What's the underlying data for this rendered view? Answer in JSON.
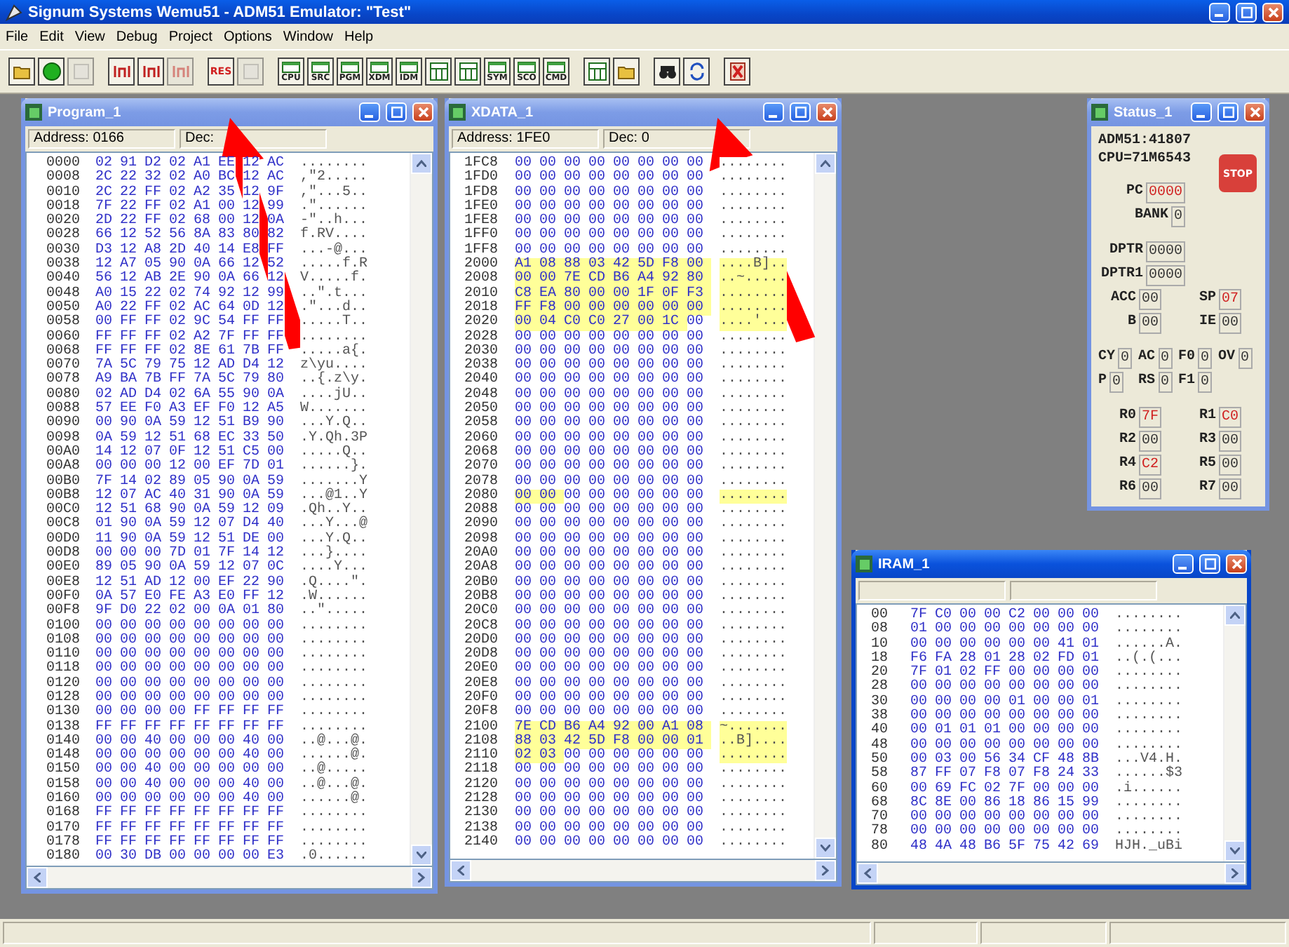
{
  "app": {
    "title": "Signum Systems Wemu51 - ADM51 Emulator: \"Test\""
  },
  "menu": [
    "File",
    "Edit",
    "View",
    "Debug",
    "Project",
    "Options",
    "Window",
    "Help"
  ],
  "toolbar": [
    [
      {
        "kind": "open",
        "disabled": false
      },
      {
        "kind": "go",
        "disabled": false
      },
      {
        "kind": "blank",
        "disabled": true
      }
    ],
    [
      {
        "kind": "step-into",
        "disabled": false
      },
      {
        "kind": "step-over",
        "disabled": false
      },
      {
        "kind": "step-out",
        "disabled": true
      }
    ],
    [
      {
        "kind": "label",
        "label": "RES",
        "disabled": false
      },
      {
        "kind": "blank",
        "disabled": true
      }
    ],
    [
      {
        "kind": "window",
        "label": "CPU",
        "disabled": false
      },
      {
        "kind": "window",
        "label": "SRC",
        "disabled": false
      },
      {
        "kind": "window",
        "label": "PGM",
        "disabled": false
      },
      {
        "kind": "window",
        "label": "XDM",
        "disabled": false
      },
      {
        "kind": "window",
        "label": "IDM",
        "disabled": false
      },
      {
        "kind": "grid",
        "disabled": false
      },
      {
        "kind": "grid",
        "disabled": false
      },
      {
        "kind": "window",
        "label": "SYM",
        "disabled": false
      },
      {
        "kind": "window",
        "label": "SCO",
        "disabled": false
      },
      {
        "kind": "window",
        "label": "CMD",
        "disabled": false
      }
    ],
    [
      {
        "kind": "grid",
        "disabled": false
      },
      {
        "kind": "open",
        "disabled": false
      }
    ],
    [
      {
        "kind": "find",
        "disabled": false
      },
      {
        "kind": "refresh",
        "disabled": false
      }
    ],
    [
      {
        "kind": "delete",
        "disabled": false
      }
    ]
  ],
  "program": {
    "title": "Program_1",
    "active": false,
    "address": "Address: 0166",
    "dec": "Dec:",
    "rows": [
      {
        "address": "0000",
        "bytes": [
          "02",
          "91",
          "D2",
          "02",
          "A1",
          "EE",
          "12",
          "AC"
        ],
        "ascii": "........"
      },
      {
        "address": "0008",
        "bytes": [
          "2C",
          "22",
          "32",
          "02",
          "A0",
          "BC",
          "12",
          "AC"
        ],
        "ascii": ",\"2....."
      },
      {
        "address": "0010",
        "bytes": [
          "2C",
          "22",
          "FF",
          "02",
          "A2",
          "35",
          "12",
          "9F"
        ],
        "ascii": ",\"...5.."
      },
      {
        "address": "0018",
        "bytes": [
          "7F",
          "22",
          "FF",
          "02",
          "A1",
          "00",
          "12",
          "99"
        ],
        "ascii": ".\"......"
      },
      {
        "address": "0020",
        "bytes": [
          "2D",
          "22",
          "FF",
          "02",
          "68",
          "00",
          "12",
          "0A"
        ],
        "ascii": "-\"..h..."
      },
      {
        "address": "0028",
        "bytes": [
          "66",
          "12",
          "52",
          "56",
          "8A",
          "83",
          "80",
          "82"
        ],
        "ascii": "f.RV...."
      },
      {
        "address": "0030",
        "bytes": [
          "D3",
          "12",
          "A8",
          "2D",
          "40",
          "14",
          "E8",
          "FF"
        ],
        "ascii": "...-@..."
      },
      {
        "address": "0038",
        "bytes": [
          "12",
          "A7",
          "05",
          "90",
          "0A",
          "66",
          "12",
          "52"
        ],
        "ascii": ".....f.R"
      },
      {
        "address": "0040",
        "bytes": [
          "56",
          "12",
          "AB",
          "2E",
          "90",
          "0A",
          "66",
          "12"
        ],
        "ascii": "V.....f."
      },
      {
        "address": "0048",
        "bytes": [
          "A0",
          "15",
          "22",
          "02",
          "74",
          "92",
          "12",
          "99"
        ],
        "ascii": "..\".t..."
      },
      {
        "address": "0050",
        "bytes": [
          "A0",
          "22",
          "FF",
          "02",
          "AC",
          "64",
          "0D",
          "12"
        ],
        "ascii": ".\"...d.."
      },
      {
        "address": "0058",
        "bytes": [
          "00",
          "FF",
          "FF",
          "02",
          "9C",
          "54",
          "FF",
          "FF"
        ],
        "ascii": ".....T.."
      },
      {
        "address": "0060",
        "bytes": [
          "FF",
          "FF",
          "FF",
          "02",
          "A2",
          "7F",
          "FF",
          "FF"
        ],
        "ascii": "........"
      },
      {
        "address": "0068",
        "bytes": [
          "FF",
          "FF",
          "FF",
          "02",
          "8E",
          "61",
          "7B",
          "FF"
        ],
        "ascii": ".....a{."
      },
      {
        "address": "0070",
        "bytes": [
          "7A",
          "5C",
          "79",
          "75",
          "12",
          "AD",
          "D4",
          "12"
        ],
        "ascii": "z\\yu...."
      },
      {
        "address": "0078",
        "bytes": [
          "A9",
          "BA",
          "7B",
          "FF",
          "7A",
          "5C",
          "79",
          "80"
        ],
        "ascii": "..{.z\\y."
      },
      {
        "address": "0080",
        "bytes": [
          "02",
          "AD",
          "D4",
          "02",
          "6A",
          "55",
          "90",
          "0A"
        ],
        "ascii": "....jU.."
      },
      {
        "address": "0088",
        "bytes": [
          "57",
          "EE",
          "F0",
          "A3",
          "EF",
          "F0",
          "12",
          "A5"
        ],
        "ascii": "W......."
      },
      {
        "address": "0090",
        "bytes": [
          "00",
          "90",
          "0A",
          "59",
          "12",
          "51",
          "B9",
          "90"
        ],
        "ascii": "...Y.Q.."
      },
      {
        "address": "0098",
        "bytes": [
          "0A",
          "59",
          "12",
          "51",
          "68",
          "EC",
          "33",
          "50"
        ],
        "ascii": ".Y.Qh.3P"
      },
      {
        "address": "00A0",
        "bytes": [
          "14",
          "12",
          "07",
          "0F",
          "12",
          "51",
          "C5",
          "00"
        ],
        "ascii": ".....Q.."
      },
      {
        "address": "00A8",
        "bytes": [
          "00",
          "00",
          "00",
          "12",
          "00",
          "EF",
          "7D",
          "01"
        ],
        "ascii": "......}."
      },
      {
        "address": "00B0",
        "bytes": [
          "7F",
          "14",
          "02",
          "89",
          "05",
          "90",
          "0A",
          "59"
        ],
        "ascii": ".......Y"
      },
      {
        "address": "00B8",
        "bytes": [
          "12",
          "07",
          "AC",
          "40",
          "31",
          "90",
          "0A",
          "59"
        ],
        "ascii": "...@1..Y"
      },
      {
        "address": "00C0",
        "bytes": [
          "12",
          "51",
          "68",
          "90",
          "0A",
          "59",
          "12",
          "09"
        ],
        "ascii": ".Qh..Y.."
      },
      {
        "address": "00C8",
        "bytes": [
          "01",
          "90",
          "0A",
          "59",
          "12",
          "07",
          "D4",
          "40"
        ],
        "ascii": "...Y...@"
      },
      {
        "address": "00D0",
        "bytes": [
          "11",
          "90",
          "0A",
          "59",
          "12",
          "51",
          "DE",
          "00"
        ],
        "ascii": "...Y.Q.."
      },
      {
        "address": "00D8",
        "bytes": [
          "00",
          "00",
          "00",
          "7D",
          "01",
          "7F",
          "14",
          "12"
        ],
        "ascii": "...}...."
      },
      {
        "address": "00E0",
        "bytes": [
          "89",
          "05",
          "90",
          "0A",
          "59",
          "12",
          "07",
          "0C"
        ],
        "ascii": "....Y..."
      },
      {
        "address": "00E8",
        "bytes": [
          "12",
          "51",
          "AD",
          "12",
          "00",
          "EF",
          "22",
          "90"
        ],
        "ascii": ".Q....\"."
      },
      {
        "address": "00F0",
        "bytes": [
          "0A",
          "57",
          "E0",
          "FE",
          "A3",
          "E0",
          "FF",
          "12"
        ],
        "ascii": ".W......"
      },
      {
        "address": "00F8",
        "bytes": [
          "9F",
          "D0",
          "22",
          "02",
          "00",
          "0A",
          "01",
          "80"
        ],
        "ascii": "..\"....."
      },
      {
        "address": "0100",
        "bytes": [
          "00",
          "00",
          "00",
          "00",
          "00",
          "00",
          "00",
          "00"
        ],
        "ascii": "........"
      },
      {
        "address": "0108",
        "bytes": [
          "00",
          "00",
          "00",
          "00",
          "00",
          "00",
          "00",
          "00"
        ],
        "ascii": "........"
      },
      {
        "address": "0110",
        "bytes": [
          "00",
          "00",
          "00",
          "00",
          "00",
          "00",
          "00",
          "00"
        ],
        "ascii": "........"
      },
      {
        "address": "0118",
        "bytes": [
          "00",
          "00",
          "00",
          "00",
          "00",
          "00",
          "00",
          "00"
        ],
        "ascii": "........"
      },
      {
        "address": "0120",
        "bytes": [
          "00",
          "00",
          "00",
          "00",
          "00",
          "00",
          "00",
          "00"
        ],
        "ascii": "........"
      },
      {
        "address": "0128",
        "bytes": [
          "00",
          "00",
          "00",
          "00",
          "00",
          "00",
          "00",
          "00"
        ],
        "ascii": "........"
      },
      {
        "address": "0130",
        "bytes": [
          "00",
          "00",
          "00",
          "00",
          "FF",
          "FF",
          "FF",
          "FF"
        ],
        "ascii": "........"
      },
      {
        "address": "0138",
        "bytes": [
          "FF",
          "FF",
          "FF",
          "FF",
          "FF",
          "FF",
          "FF",
          "FF"
        ],
        "ascii": "........"
      },
      {
        "address": "0140",
        "bytes": [
          "00",
          "00",
          "40",
          "00",
          "00",
          "00",
          "40",
          "00"
        ],
        "ascii": "..@...@."
      },
      {
        "address": "0148",
        "bytes": [
          "00",
          "00",
          "00",
          "00",
          "00",
          "00",
          "40",
          "00"
        ],
        "ascii": "......@."
      },
      {
        "address": "0150",
        "bytes": [
          "00",
          "00",
          "40",
          "00",
          "00",
          "00",
          "00",
          "00"
        ],
        "ascii": "..@....."
      },
      {
        "address": "0158",
        "bytes": [
          "00",
          "00",
          "40",
          "00",
          "00",
          "00",
          "40",
          "00"
        ],
        "ascii": "..@...@."
      },
      {
        "address": "0160",
        "bytes": [
          "00",
          "00",
          "00",
          "00",
          "00",
          "00",
          "40",
          "00"
        ],
        "ascii": "......@."
      },
      {
        "address": "0168",
        "bytes": [
          "FF",
          "FF",
          "FF",
          "FF",
          "FF",
          "FF",
          "FF",
          "FF"
        ],
        "ascii": "........"
      },
      {
        "address": "0170",
        "bytes": [
          "FF",
          "FF",
          "FF",
          "FF",
          "FF",
          "FF",
          "FF",
          "FF"
        ],
        "ascii": "........"
      },
      {
        "address": "0178",
        "bytes": [
          "FF",
          "FF",
          "FF",
          "FF",
          "FF",
          "FF",
          "FF",
          "FF"
        ],
        "ascii": "........"
      },
      {
        "address": "0180",
        "bytes": [
          "00",
          "30",
          "DB",
          "00",
          "00",
          "00",
          "00",
          "E3"
        ],
        "ascii": ".0......"
      }
    ]
  },
  "xdata": {
    "title": "XDATA_1",
    "active": false,
    "address": "Address: 1FE0",
    "dec": "Dec:  0",
    "rows": [
      {
        "address": "1FC8",
        "bytes": [
          "00",
          "00",
          "00",
          "00",
          "00",
          "00",
          "00",
          "00"
        ],
        "ascii": "........"
      },
      {
        "address": "1FD0",
        "bytes": [
          "00",
          "00",
          "00",
          "00",
          "00",
          "00",
          "00",
          "00"
        ],
        "ascii": "........"
      },
      {
        "address": "1FD8",
        "bytes": [
          "00",
          "00",
          "00",
          "00",
          "00",
          "00",
          "00",
          "00"
        ],
        "ascii": "........"
      },
      {
        "address": "1FE0",
        "bytes": [
          "00",
          "00",
          "00",
          "00",
          "00",
          "00",
          "00",
          "00"
        ],
        "ascii": "........"
      },
      {
        "address": "1FE8",
        "bytes": [
          "00",
          "00",
          "00",
          "00",
          "00",
          "00",
          "00",
          "00"
        ],
        "ascii": "........"
      },
      {
        "address": "1FF0",
        "bytes": [
          "00",
          "00",
          "00",
          "00",
          "00",
          "00",
          "00",
          "00"
        ],
        "ascii": "........"
      },
      {
        "address": "1FF8",
        "bytes": [
          "00",
          "00",
          "00",
          "00",
          "00",
          "00",
          "00",
          "00"
        ],
        "ascii": "........"
      },
      {
        "address": "2000",
        "bytes": [
          "A1",
          "08",
          "88",
          "03",
          "42",
          "5D",
          "F8",
          "00"
        ],
        "ascii": "....B]..",
        "changed": [
          true,
          true,
          true,
          true,
          true,
          true,
          true,
          true
        ],
        "ascii_changed": true
      },
      {
        "address": "2008",
        "bytes": [
          "00",
          "00",
          "7E",
          "CD",
          "B6",
          "A4",
          "92",
          "80"
        ],
        "ascii": "..~.....",
        "changed": [
          true,
          true,
          true,
          true,
          true,
          true,
          true,
          true
        ],
        "ascii_changed": true
      },
      {
        "address": "2010",
        "bytes": [
          "C8",
          "EA",
          "80",
          "00",
          "00",
          "1F",
          "0F",
          "F3"
        ],
        "ascii": "........",
        "changed": [
          true,
          true,
          true,
          true,
          true,
          true,
          true,
          true
        ],
        "ascii_changed": true
      },
      {
        "address": "2018",
        "bytes": [
          "FF",
          "F8",
          "00",
          "00",
          "00",
          "00",
          "00",
          "00"
        ],
        "ascii": "........",
        "changed": [
          true,
          true,
          true,
          true,
          true,
          true,
          true,
          true
        ],
        "ascii_changed": true
      },
      {
        "address": "2020",
        "bytes": [
          "00",
          "04",
          "C0",
          "C0",
          "27",
          "00",
          "1C",
          "00"
        ],
        "ascii": "....'...",
        "changed": [
          true,
          true,
          true,
          true,
          true,
          true,
          true,
          false
        ],
        "ascii_changed": true
      },
      {
        "address": "2028",
        "bytes": [
          "00",
          "00",
          "00",
          "00",
          "00",
          "00",
          "00",
          "00"
        ],
        "ascii": "........"
      },
      {
        "address": "2030",
        "bytes": [
          "00",
          "00",
          "00",
          "00",
          "00",
          "00",
          "00",
          "00"
        ],
        "ascii": "........"
      },
      {
        "address": "2038",
        "bytes": [
          "00",
          "00",
          "00",
          "00",
          "00",
          "00",
          "00",
          "00"
        ],
        "ascii": "........"
      },
      {
        "address": "2040",
        "bytes": [
          "00",
          "00",
          "00",
          "00",
          "00",
          "00",
          "00",
          "00"
        ],
        "ascii": "........"
      },
      {
        "address": "2048",
        "bytes": [
          "00",
          "00",
          "00",
          "00",
          "00",
          "00",
          "00",
          "00"
        ],
        "ascii": "........"
      },
      {
        "address": "2050",
        "bytes": [
          "00",
          "00",
          "00",
          "00",
          "00",
          "00",
          "00",
          "00"
        ],
        "ascii": "........"
      },
      {
        "address": "2058",
        "bytes": [
          "00",
          "00",
          "00",
          "00",
          "00",
          "00",
          "00",
          "00"
        ],
        "ascii": "........"
      },
      {
        "address": "2060",
        "bytes": [
          "00",
          "00",
          "00",
          "00",
          "00",
          "00",
          "00",
          "00"
        ],
        "ascii": "........"
      },
      {
        "address": "2068",
        "bytes": [
          "00",
          "00",
          "00",
          "00",
          "00",
          "00",
          "00",
          "00"
        ],
        "ascii": "........"
      },
      {
        "address": "2070",
        "bytes": [
          "00",
          "00",
          "00",
          "00",
          "00",
          "00",
          "00",
          "00"
        ],
        "ascii": "........"
      },
      {
        "address": "2078",
        "bytes": [
          "00",
          "00",
          "00",
          "00",
          "00",
          "00",
          "00",
          "00"
        ],
        "ascii": "........"
      },
      {
        "address": "2080",
        "bytes": [
          "00",
          "00",
          "00",
          "00",
          "00",
          "00",
          "00",
          "00"
        ],
        "ascii": "........",
        "changed": [
          true,
          true,
          false,
          false,
          false,
          false,
          false,
          false
        ],
        "ascii_changed": true
      },
      {
        "address": "2088",
        "bytes": [
          "00",
          "00",
          "00",
          "00",
          "00",
          "00",
          "00",
          "00"
        ],
        "ascii": "........"
      },
      {
        "address": "2090",
        "bytes": [
          "00",
          "00",
          "00",
          "00",
          "00",
          "00",
          "00",
          "00"
        ],
        "ascii": "........"
      },
      {
        "address": "2098",
        "bytes": [
          "00",
          "00",
          "00",
          "00",
          "00",
          "00",
          "00",
          "00"
        ],
        "ascii": "........"
      },
      {
        "address": "20A0",
        "bytes": [
          "00",
          "00",
          "00",
          "00",
          "00",
          "00",
          "00",
          "00"
        ],
        "ascii": "........"
      },
      {
        "address": "20A8",
        "bytes": [
          "00",
          "00",
          "00",
          "00",
          "00",
          "00",
          "00",
          "00"
        ],
        "ascii": "........"
      },
      {
        "address": "20B0",
        "bytes": [
          "00",
          "00",
          "00",
          "00",
          "00",
          "00",
          "00",
          "00"
        ],
        "ascii": "........"
      },
      {
        "address": "20B8",
        "bytes": [
          "00",
          "00",
          "00",
          "00",
          "00",
          "00",
          "00",
          "00"
        ],
        "ascii": "........"
      },
      {
        "address": "20C0",
        "bytes": [
          "00",
          "00",
          "00",
          "00",
          "00",
          "00",
          "00",
          "00"
        ],
        "ascii": "........"
      },
      {
        "address": "20C8",
        "bytes": [
          "00",
          "00",
          "00",
          "00",
          "00",
          "00",
          "00",
          "00"
        ],
        "ascii": "........"
      },
      {
        "address": "20D0",
        "bytes": [
          "00",
          "00",
          "00",
          "00",
          "00",
          "00",
          "00",
          "00"
        ],
        "ascii": "........"
      },
      {
        "address": "20D8",
        "bytes": [
          "00",
          "00",
          "00",
          "00",
          "00",
          "00",
          "00",
          "00"
        ],
        "ascii": "........"
      },
      {
        "address": "20E0",
        "bytes": [
          "00",
          "00",
          "00",
          "00",
          "00",
          "00",
          "00",
          "00"
        ],
        "ascii": "........"
      },
      {
        "address": "20E8",
        "bytes": [
          "00",
          "00",
          "00",
          "00",
          "00",
          "00",
          "00",
          "00"
        ],
        "ascii": "........"
      },
      {
        "address": "20F0",
        "bytes": [
          "00",
          "00",
          "00",
          "00",
          "00",
          "00",
          "00",
          "00"
        ],
        "ascii": "........"
      },
      {
        "address": "20F8",
        "bytes": [
          "00",
          "00",
          "00",
          "00",
          "00",
          "00",
          "00",
          "00"
        ],
        "ascii": "........"
      },
      {
        "address": "2100",
        "bytes": [
          "7E",
          "CD",
          "B6",
          "A4",
          "92",
          "00",
          "A1",
          "08"
        ],
        "ascii": "~.......",
        "changed": [
          true,
          true,
          true,
          true,
          true,
          true,
          true,
          true
        ],
        "ascii_changed": true
      },
      {
        "address": "2108",
        "bytes": [
          "88",
          "03",
          "42",
          "5D",
          "F8",
          "00",
          "00",
          "01"
        ],
        "ascii": "..B]....",
        "changed": [
          true,
          true,
          true,
          true,
          true,
          true,
          true,
          true
        ],
        "ascii_changed": true
      },
      {
        "address": "2110",
        "bytes": [
          "02",
          "03",
          "00",
          "00",
          "00",
          "00",
          "00",
          "00"
        ],
        "ascii": "........",
        "changed": [
          true,
          true,
          false,
          false,
          false,
          false,
          false,
          false
        ],
        "ascii_changed": true
      },
      {
        "address": "2118",
        "bytes": [
          "00",
          "00",
          "00",
          "00",
          "00",
          "00",
          "00",
          "00"
        ],
        "ascii": "........"
      },
      {
        "address": "2120",
        "bytes": [
          "00",
          "00",
          "00",
          "00",
          "00",
          "00",
          "00",
          "00"
        ],
        "ascii": "........"
      },
      {
        "address": "2128",
        "bytes": [
          "00",
          "00",
          "00",
          "00",
          "00",
          "00",
          "00",
          "00"
        ],
        "ascii": "........"
      },
      {
        "address": "2130",
        "bytes": [
          "00",
          "00",
          "00",
          "00",
          "00",
          "00",
          "00",
          "00"
        ],
        "ascii": "........"
      },
      {
        "address": "2138",
        "bytes": [
          "00",
          "00",
          "00",
          "00",
          "00",
          "00",
          "00",
          "00"
        ],
        "ascii": "........"
      },
      {
        "address": "2140",
        "bytes": [
          "00",
          "00",
          "00",
          "00",
          "00",
          "00",
          "00",
          "00"
        ],
        "ascii": "........"
      }
    ]
  },
  "status": {
    "title": "Status_1",
    "active": false,
    "device": "ADM51:41807",
    "cpu": "CPU=71M6543",
    "stop": "STOP",
    "sections": [
      [
        [
          {
            "label": "PC",
            "value": "0000",
            "changed": true
          }
        ],
        [
          {
            "label": "BANK",
            "value": "0",
            "changed": false
          }
        ]
      ],
      [
        [
          {
            "label": "DPTR",
            "value": "0000",
            "changed": false
          }
        ],
        [
          {
            "label": "DPTR1",
            "value": "0000",
            "changed": false
          }
        ],
        [
          {
            "label": "ACC",
            "value": "00",
            "changed": false
          },
          {
            "label": "SP",
            "value": "07",
            "changed": true
          }
        ],
        [
          {
            "label": "B",
            "value": "00",
            "changed": false
          },
          {
            "label": "IE",
            "value": "00",
            "changed": false
          }
        ]
      ],
      [
        [
          {
            "label": "CY",
            "value": "0",
            "changed": false
          },
          {
            "label": "AC",
            "value": "0",
            "changed": false
          },
          {
            "label": "F0",
            "value": "0",
            "changed": false
          },
          {
            "label": "OV",
            "value": "0",
            "changed": false
          }
        ],
        [
          {
            "label": "P",
            "value": "0",
            "changed": false
          },
          {
            "label": "RS",
            "value": "0",
            "changed": false
          },
          {
            "label": "F1",
            "value": "0",
            "changed": false
          }
        ]
      ],
      [
        [
          {
            "label": "R0",
            "value": "7F",
            "changed": true
          },
          {
            "label": "R1",
            "value": "C0",
            "changed": true
          }
        ],
        [
          {
            "label": "R2",
            "value": "00",
            "changed": false
          },
          {
            "label": "R3",
            "value": "00",
            "changed": false
          }
        ],
        [
          {
            "label": "R4",
            "value": "C2",
            "changed": true
          },
          {
            "label": "R5",
            "value": "00",
            "changed": false
          }
        ],
        [
          {
            "label": "R6",
            "value": "00",
            "changed": false
          },
          {
            "label": "R7",
            "value": "00",
            "changed": false
          }
        ]
      ]
    ]
  },
  "iram": {
    "title": "IRAM_1",
    "active": true,
    "rows": [
      {
        "address": "00",
        "bytes": [
          "7F",
          "C0",
          "00",
          "00",
          "C2",
          "00",
          "00",
          "00"
        ],
        "ascii": "........"
      },
      {
        "address": "08",
        "bytes": [
          "01",
          "00",
          "00",
          "00",
          "00",
          "00",
          "00",
          "00"
        ],
        "ascii": "........"
      },
      {
        "address": "10",
        "bytes": [
          "00",
          "00",
          "00",
          "00",
          "00",
          "00",
          "41",
          "01"
        ],
        "ascii": "......A."
      },
      {
        "address": "18",
        "bytes": [
          "F6",
          "FA",
          "28",
          "01",
          "28",
          "02",
          "FD",
          "01"
        ],
        "ascii": "..(.(..."
      },
      {
        "address": "20",
        "bytes": [
          "7F",
          "01",
          "02",
          "FF",
          "00",
          "00",
          "00",
          "00"
        ],
        "ascii": "........"
      },
      {
        "address": "28",
        "bytes": [
          "00",
          "00",
          "00",
          "00",
          "00",
          "00",
          "00",
          "00"
        ],
        "ascii": "........"
      },
      {
        "address": "30",
        "bytes": [
          "00",
          "00",
          "00",
          "00",
          "01",
          "00",
          "00",
          "01"
        ],
        "ascii": "........"
      },
      {
        "address": "38",
        "bytes": [
          "00",
          "00",
          "00",
          "00",
          "00",
          "00",
          "00",
          "00"
        ],
        "ascii": "........"
      },
      {
        "address": "40",
        "bytes": [
          "00",
          "01",
          "01",
          "01",
          "00",
          "00",
          "00",
          "00"
        ],
        "ascii": "........"
      },
      {
        "address": "48",
        "bytes": [
          "00",
          "00",
          "00",
          "00",
          "00",
          "00",
          "00",
          "00"
        ],
        "ascii": "........"
      },
      {
        "address": "50",
        "bytes": [
          "00",
          "03",
          "00",
          "56",
          "34",
          "CF",
          "48",
          "8B"
        ],
        "ascii": "...V4.H."
      },
      {
        "address": "58",
        "bytes": [
          "87",
          "FF",
          "07",
          "F8",
          "07",
          "F8",
          "24",
          "33"
        ],
        "ascii": "......$3"
      },
      {
        "address": "60",
        "bytes": [
          "00",
          "69",
          "FC",
          "02",
          "7F",
          "00",
          "00",
          "00"
        ],
        "ascii": ".i......"
      },
      {
        "address": "68",
        "bytes": [
          "8C",
          "8E",
          "00",
          "86",
          "18",
          "86",
          "15",
          "99"
        ],
        "ascii": "........"
      },
      {
        "address": "70",
        "bytes": [
          "00",
          "00",
          "00",
          "00",
          "00",
          "00",
          "00",
          "00"
        ],
        "ascii": "........"
      },
      {
        "address": "78",
        "bytes": [
          "00",
          "00",
          "00",
          "00",
          "00",
          "00",
          "00",
          "00"
        ],
        "ascii": "........"
      },
      {
        "address": "80",
        "bytes": [
          "48",
          "4A",
          "48",
          "B6",
          "5F",
          "75",
          "42",
          "69"
        ],
        "ascii": "HJH._uBi"
      }
    ]
  }
}
